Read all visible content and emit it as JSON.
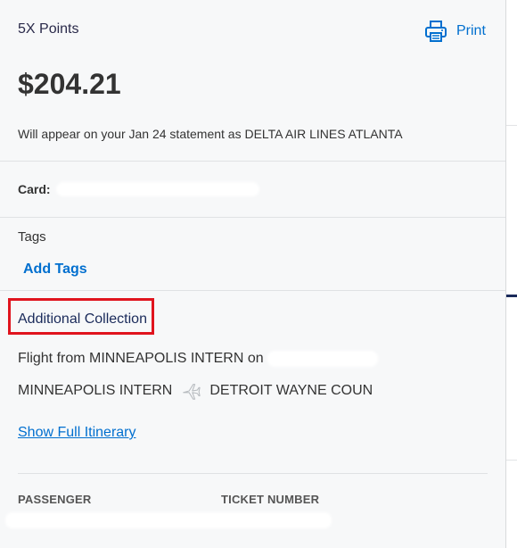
{
  "header": {
    "reward_label": "5X Points",
    "print_label": "Print",
    "amount": "$204.21",
    "statement_note": "Will appear on your Jan 24 statement as DELTA AIR LINES ATLANTA"
  },
  "card": {
    "label": "Card:"
  },
  "tags": {
    "label": "Tags",
    "add_label": "Add Tags"
  },
  "additional": {
    "title": "Additional Collection",
    "flight_text": "Flight from MINNEAPOLIS INTERN on",
    "origin": "MINNEAPOLIS INTERN",
    "destination": "DETROIT WAYNE COUN",
    "itinerary_link": "Show Full Itinerary"
  },
  "passenger_table": {
    "columns": [
      "PASSENGER",
      "TICKET NUMBER"
    ]
  },
  "colors": {
    "accent_blue": "#006fcf",
    "highlight_red": "#e0141e",
    "navy_text": "#1a2a5a"
  },
  "icons": {
    "print": "printer-icon",
    "plane": "airplane-icon"
  }
}
